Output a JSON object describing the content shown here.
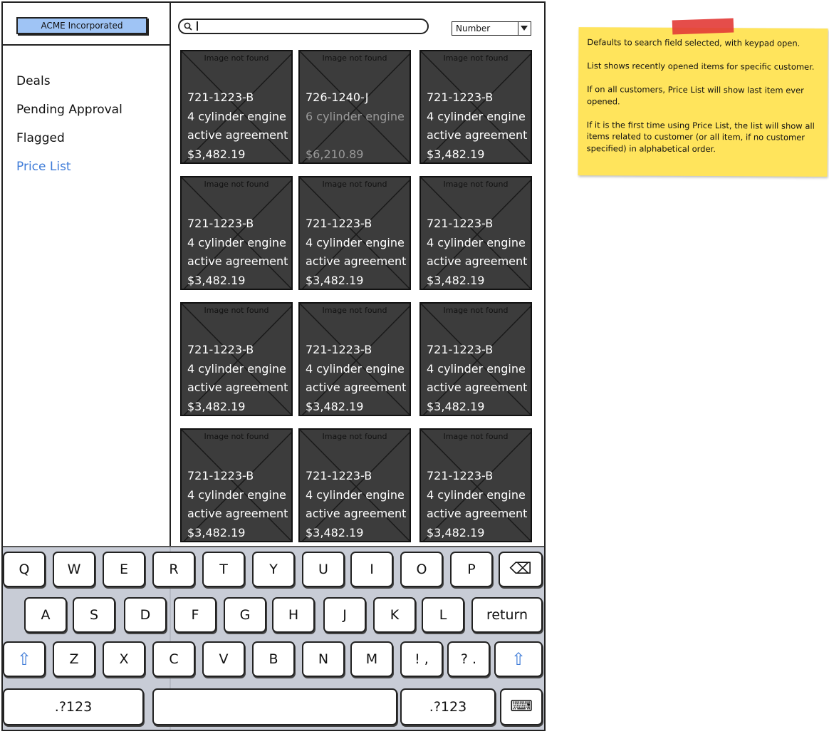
{
  "sidebar": {
    "company": "ACME Incorporated",
    "nav": [
      "Deals",
      "Pending Approval",
      "Flagged",
      "Price List"
    ],
    "active_index": 3,
    "active_color": "#3f7cd8"
  },
  "search": {
    "value": "",
    "icon": "search-icon"
  },
  "sort_select": {
    "value": "Number"
  },
  "placeholder_text": "Image not found",
  "items": [
    {
      "part": "721-1223-B",
      "desc": "4 cylinder engine",
      "status": "active agreement",
      "price": "$3,482.19",
      "faded": false
    },
    {
      "part": "726-1240-J",
      "desc": "6 cylinder engine",
      "status": "",
      "price": "$6,210.89",
      "faded": true
    },
    {
      "part": "721-1223-B",
      "desc": "4 cylinder engine",
      "status": "active agreement",
      "price": "$3,482.19",
      "faded": false
    },
    {
      "part": "721-1223-B",
      "desc": "4 cylinder engine",
      "status": "active agreement",
      "price": "$3,482.19",
      "faded": false
    },
    {
      "part": "721-1223-B",
      "desc": "4 cylinder engine",
      "status": "active agreement",
      "price": "$3,482.19",
      "faded": false
    },
    {
      "part": "721-1223-B",
      "desc": "4 cylinder engine",
      "status": "active agreement",
      "price": "$3,482.19",
      "faded": false
    },
    {
      "part": "721-1223-B",
      "desc": "4 cylinder engine",
      "status": "active agreement",
      "price": "$3,482.19",
      "faded": false
    },
    {
      "part": "721-1223-B",
      "desc": "4 cylinder engine",
      "status": "active agreement",
      "price": "$3,482.19",
      "faded": false
    },
    {
      "part": "721-1223-B",
      "desc": "4 cylinder engine",
      "status": "active agreement",
      "price": "$3,482.19",
      "faded": false
    },
    {
      "part": "721-1223-B",
      "desc": "4 cylinder engine",
      "status": "active agreement",
      "price": "$3,482.19",
      "faded": false
    },
    {
      "part": "721-1223-B",
      "desc": "4 cylinder engine",
      "status": "active agreement",
      "price": "$3,482.19",
      "faded": false
    },
    {
      "part": "721-1223-B",
      "desc": "4 cylinder engine",
      "status": "active agreement",
      "price": "$3,482.19",
      "faded": false
    }
  ],
  "keyboard": {
    "rows": [
      [
        "Q",
        "W",
        "E",
        "R",
        "T",
        "Y",
        "U",
        "I",
        "O",
        "P",
        "backspace"
      ],
      [
        "A",
        "S",
        "D",
        "F",
        "G",
        "H",
        "J",
        "K",
        "L",
        "return"
      ],
      [
        "shift",
        "Z",
        "X",
        "C",
        "V",
        "B",
        "N",
        "M",
        "! ,",
        "? .",
        "shift"
      ],
      [
        ".?123",
        "space",
        ".?123",
        "hide-keyboard"
      ]
    ]
  },
  "sticky_note": {
    "paragraphs": [
      "Defaults to search field selected, with keypad open.",
      "List shows recently opened items for specific customer.",
      "If on all customers, Price List will show last item ever opened.",
      "If it is the first time using Price List, the list will show all items related to customer (or all item, if no customer specified) in alphabetical order."
    ],
    "color": "#ffe45c",
    "tape_color": "#e23a36"
  }
}
